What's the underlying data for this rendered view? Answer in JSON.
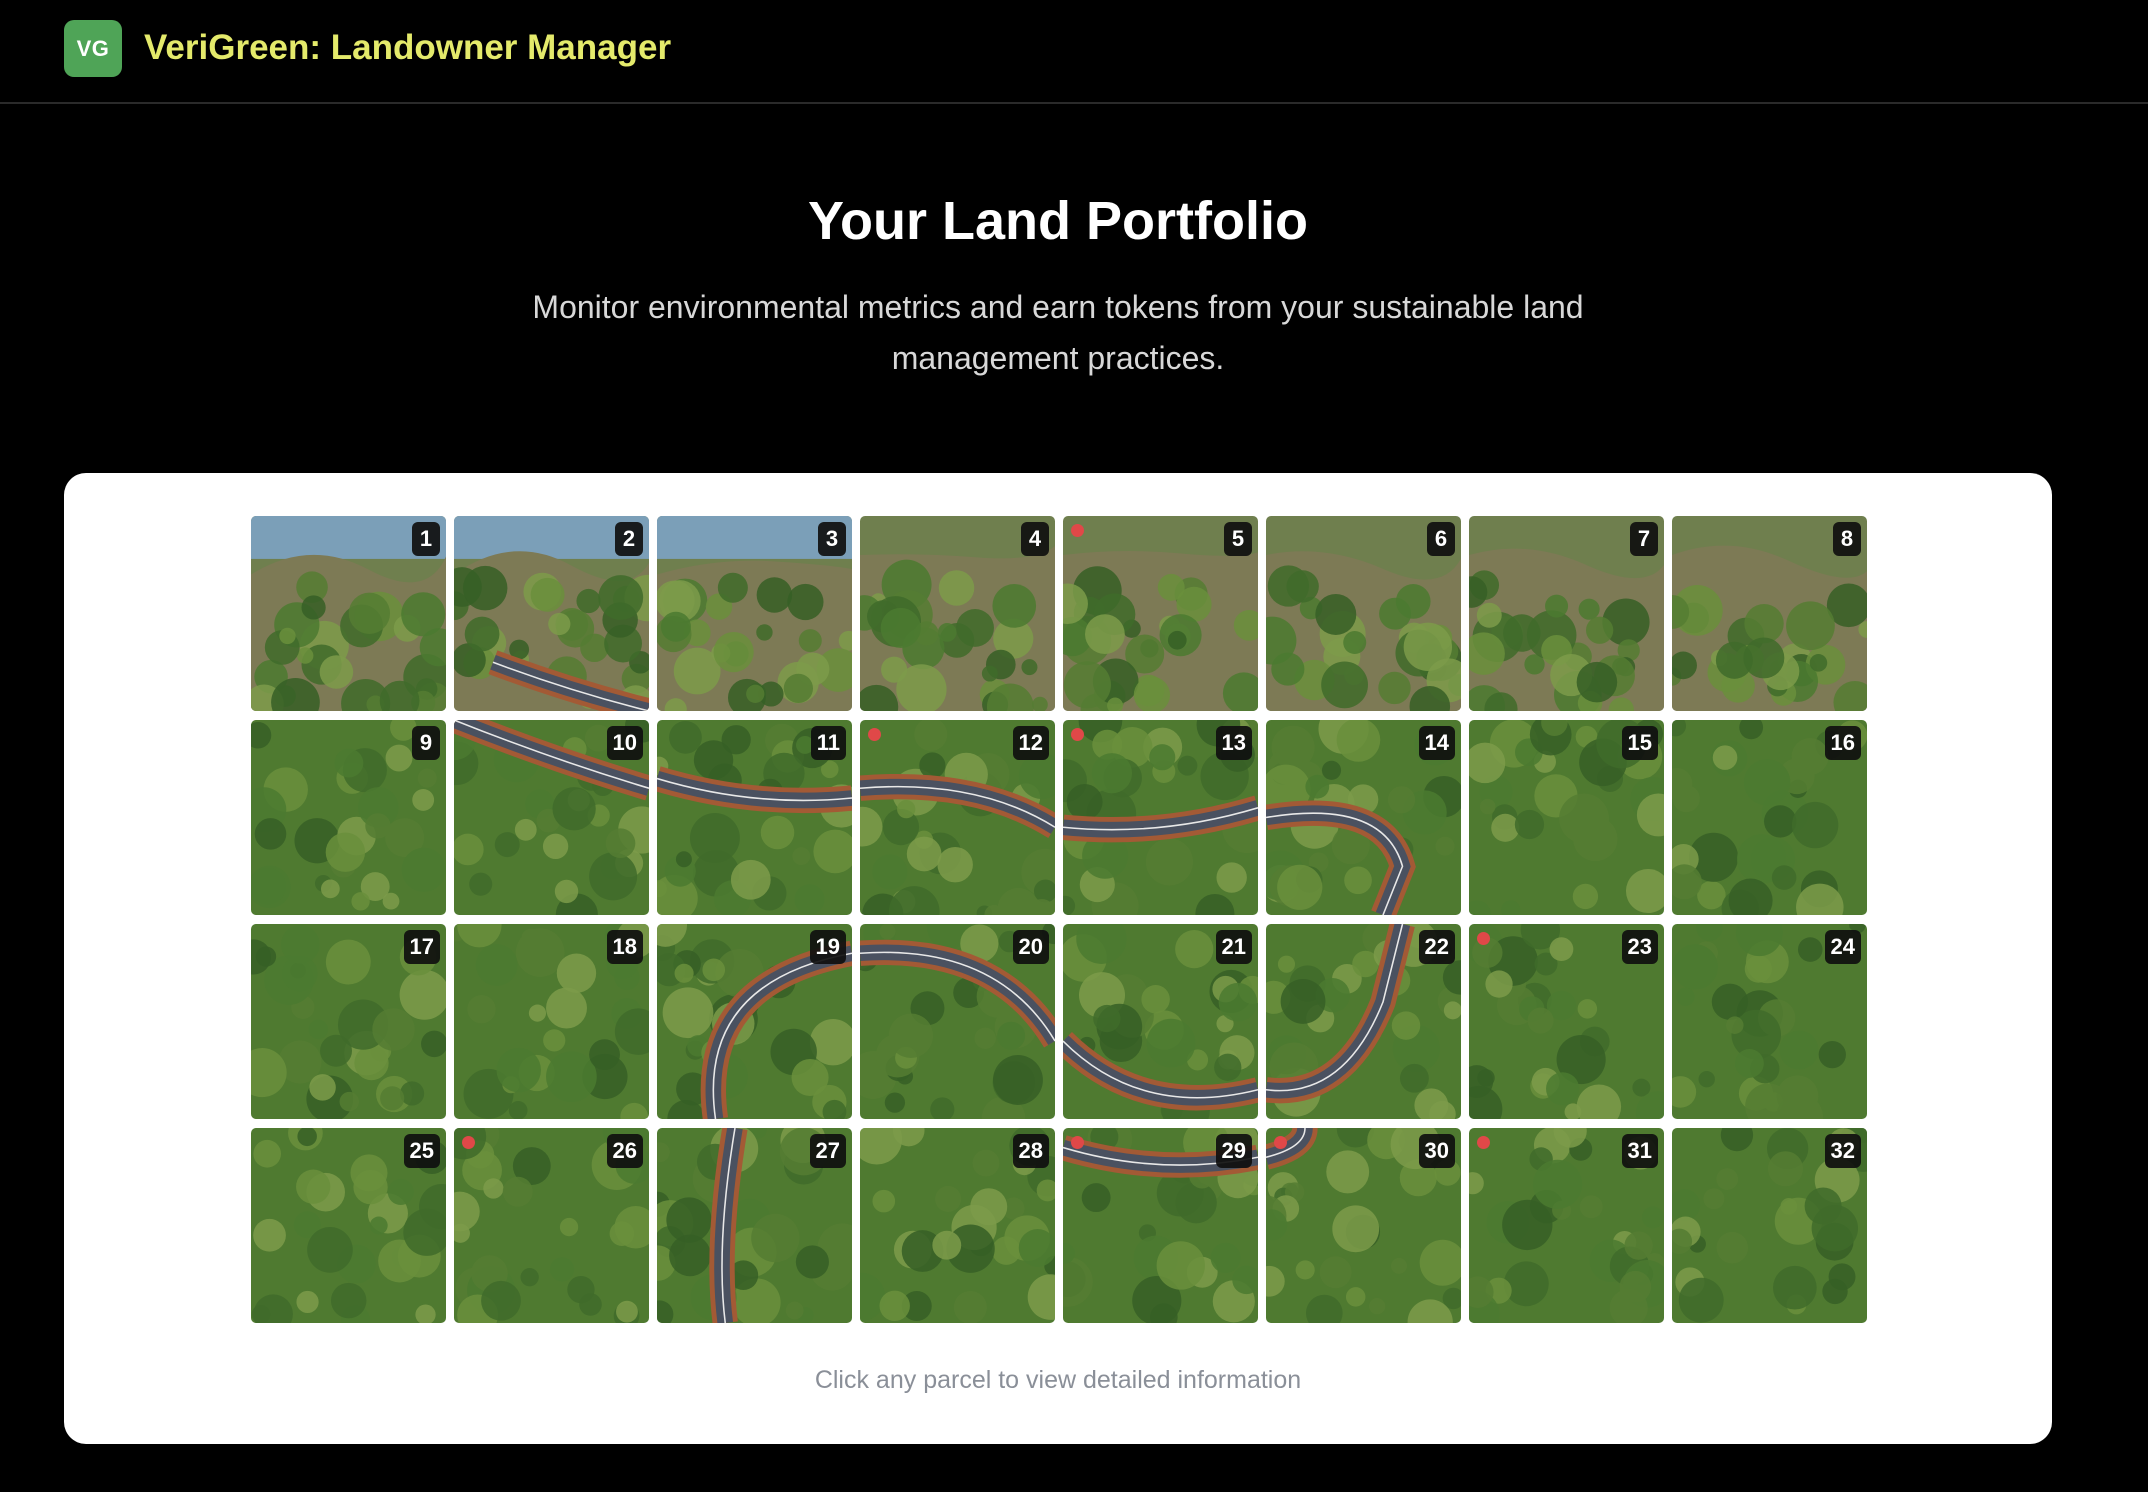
{
  "header": {
    "logo_text": "VG",
    "title": "VeriGreen: Landowner Manager",
    "title_color": "#e4ea6b",
    "logo_color": "#4fa457"
  },
  "hero": {
    "title": "Your Land Portfolio",
    "subtitle": "Monitor environmental metrics and earn tokens from your sustainable land management practices."
  },
  "parcels": [
    {
      "label": "1",
      "alert": false
    },
    {
      "label": "2",
      "alert": false
    },
    {
      "label": "3",
      "alert": false
    },
    {
      "label": "4",
      "alert": false
    },
    {
      "label": "5",
      "alert": true
    },
    {
      "label": "6",
      "alert": false
    },
    {
      "label": "7",
      "alert": false
    },
    {
      "label": "8",
      "alert": false
    },
    {
      "label": "9",
      "alert": false
    },
    {
      "label": "10",
      "alert": false
    },
    {
      "label": "11",
      "alert": false
    },
    {
      "label": "12",
      "alert": true
    },
    {
      "label": "13",
      "alert": true
    },
    {
      "label": "14",
      "alert": false
    },
    {
      "label": "15",
      "alert": false
    },
    {
      "label": "16",
      "alert": false
    },
    {
      "label": "17",
      "alert": false
    },
    {
      "label": "18",
      "alert": false
    },
    {
      "label": "19",
      "alert": false
    },
    {
      "label": "20",
      "alert": false
    },
    {
      "label": "21",
      "alert": false
    },
    {
      "label": "22",
      "alert": false
    },
    {
      "label": "23",
      "alert": true
    },
    {
      "label": "24",
      "alert": false
    },
    {
      "label": "25",
      "alert": false
    },
    {
      "label": "26",
      "alert": true
    },
    {
      "label": "27",
      "alert": false
    },
    {
      "label": "28",
      "alert": false
    },
    {
      "label": "29",
      "alert": true
    },
    {
      "label": "30",
      "alert": true
    },
    {
      "label": "31",
      "alert": true
    },
    {
      "label": "32",
      "alert": false
    }
  ],
  "hint": "Click any parcel to view detailed information",
  "alert_color": "#e04848"
}
